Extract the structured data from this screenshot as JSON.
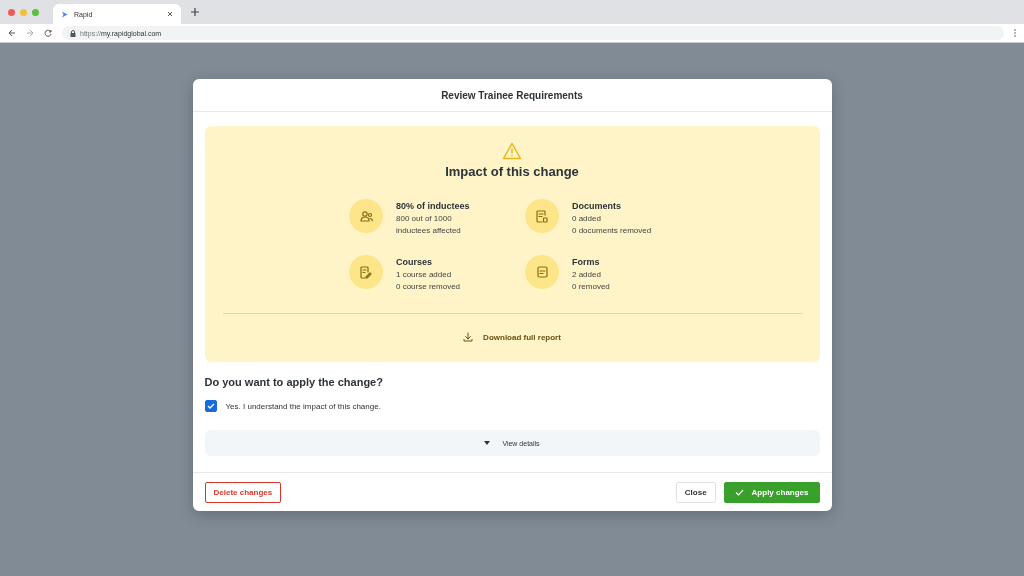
{
  "browser": {
    "tab_title": "Rapid",
    "url_scheme": "https://",
    "url_host": "my.rapidglobal.com"
  },
  "dialog": {
    "title": "Review Trainee Requirements",
    "impact": {
      "heading": "Impact of this change",
      "items": [
        {
          "kind": "people",
          "title": "80% of inductees",
          "lines": [
            "800 out of 1000",
            "inductees affected"
          ]
        },
        {
          "kind": "document",
          "title": "Documents",
          "lines": [
            "0 added",
            "0 documents removed"
          ]
        },
        {
          "kind": "course",
          "title": "Courses",
          "lines": [
            "1 course added",
            "0 course removed"
          ]
        },
        {
          "kind": "form",
          "title": "Forms",
          "lines": [
            "2 added",
            "0 removed"
          ]
        }
      ],
      "download": "Download full report"
    },
    "question": "Do you want to apply the change?",
    "confirm": {
      "label": "Yes. I understand the impact of this change.",
      "checked": true
    },
    "details": {
      "label": "View details",
      "expanded": false
    },
    "buttons": {
      "delete": "Delete changes",
      "close": "Close",
      "apply": "Apply changes"
    }
  }
}
